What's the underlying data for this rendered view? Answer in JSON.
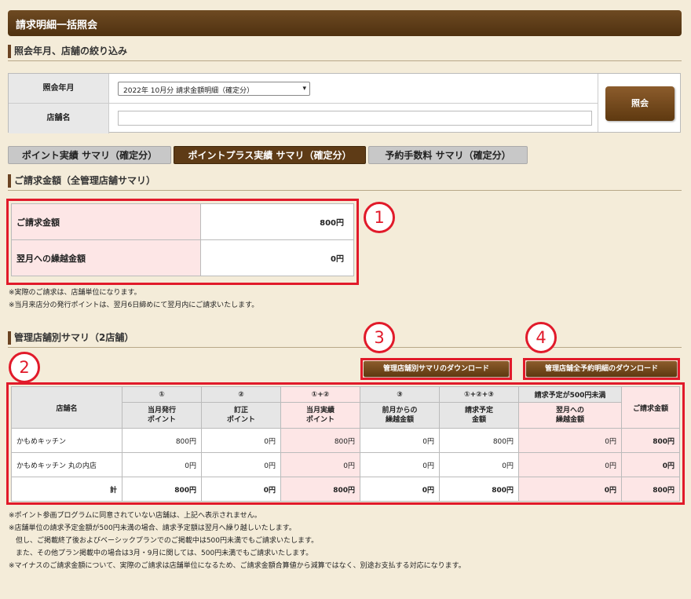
{
  "page_title": "請求明細一括照会",
  "filter_section": {
    "heading": "照会年月、店舗の絞り込み",
    "period_label": "照会年月",
    "period_value": "2022年 10月分 請求金額明細（確定分）",
    "store_label": "店舗名",
    "store_value": "",
    "query_button": "照会"
  },
  "tabs": [
    {
      "label": "ポイント実績 サマリ（確定分）",
      "active": false
    },
    {
      "label": "ポイントプラス実績 サマリ（確定分）",
      "active": true
    },
    {
      "label": "予約手数料 サマリ（確定分）",
      "active": false
    }
  ],
  "summary_section": {
    "heading": "ご請求金額（全管理店舗サマリ）",
    "rows": [
      {
        "label": "ご請求金額",
        "value": "800円"
      },
      {
        "label": "翌月への繰越金額",
        "value": "0円"
      }
    ],
    "notes": [
      "※実際のご請求は、店舗単位になります。",
      "※当月来店分の発行ポイントは、翌月6日締めにて翌月内にご請求いたします。"
    ]
  },
  "store_section": {
    "heading": "管理店舗別サマリ（2店舗）",
    "download_summary": "管理店舗別サマリのダウンロード",
    "download_detail": "管理店舗全予約明細のダウンロード",
    "header_store": "店舗名",
    "header_groups": [
      "①",
      "②",
      "①+②",
      "③",
      "①+②+③",
      "請求予定が500円未満"
    ],
    "header_subs": [
      "当月発行\nポイント",
      "訂正\nポイント",
      "当月実績\nポイント",
      "前月からの\n繰越金額",
      "請求予定\n金額",
      "翌月への\n繰越金額"
    ],
    "header_claim": "ご請求金額",
    "rows": [
      {
        "name": "かもめキッチン",
        "values": [
          "800円",
          "0円",
          "800円",
          "0円",
          "800円",
          "0円",
          "800円"
        ]
      },
      {
        "name": "かもめキッチン 丸の内店",
        "values": [
          "0円",
          "0円",
          "0円",
          "0円",
          "0円",
          "0円",
          "0円"
        ]
      }
    ],
    "total": {
      "name": "計",
      "values": [
        "800円",
        "0円",
        "800円",
        "0円",
        "800円",
        "0円",
        "800円"
      ]
    },
    "notes": [
      "※ポイント参画プログラムに同意されていない店舗は、上記へ表示されません。",
      "※店舗単位の請求予定金額が500円未満の場合、請求予定額は翌月へ繰り越しいたします。",
      "　但し、ご掲載終了後およびベーシックプランでのご掲載中は500円未満でもご請求いたします。",
      "　また、その他プラン掲載中の場合は3月・9月に関しては、500円未満でもご請求いたします。",
      "※マイナスのご請求金額について、実際のご請求は店舗単位になるため、ご請求金額合算値から減算ではなく、別途お支払する対応になります。"
    ]
  },
  "annotations": [
    "1",
    "2",
    "3",
    "4"
  ],
  "colors": {
    "brand_brown": "#5e3b16",
    "highlight_red": "#e11a2a",
    "pink_cell": "#fde6e6",
    "background": "#f4ecd9"
  }
}
